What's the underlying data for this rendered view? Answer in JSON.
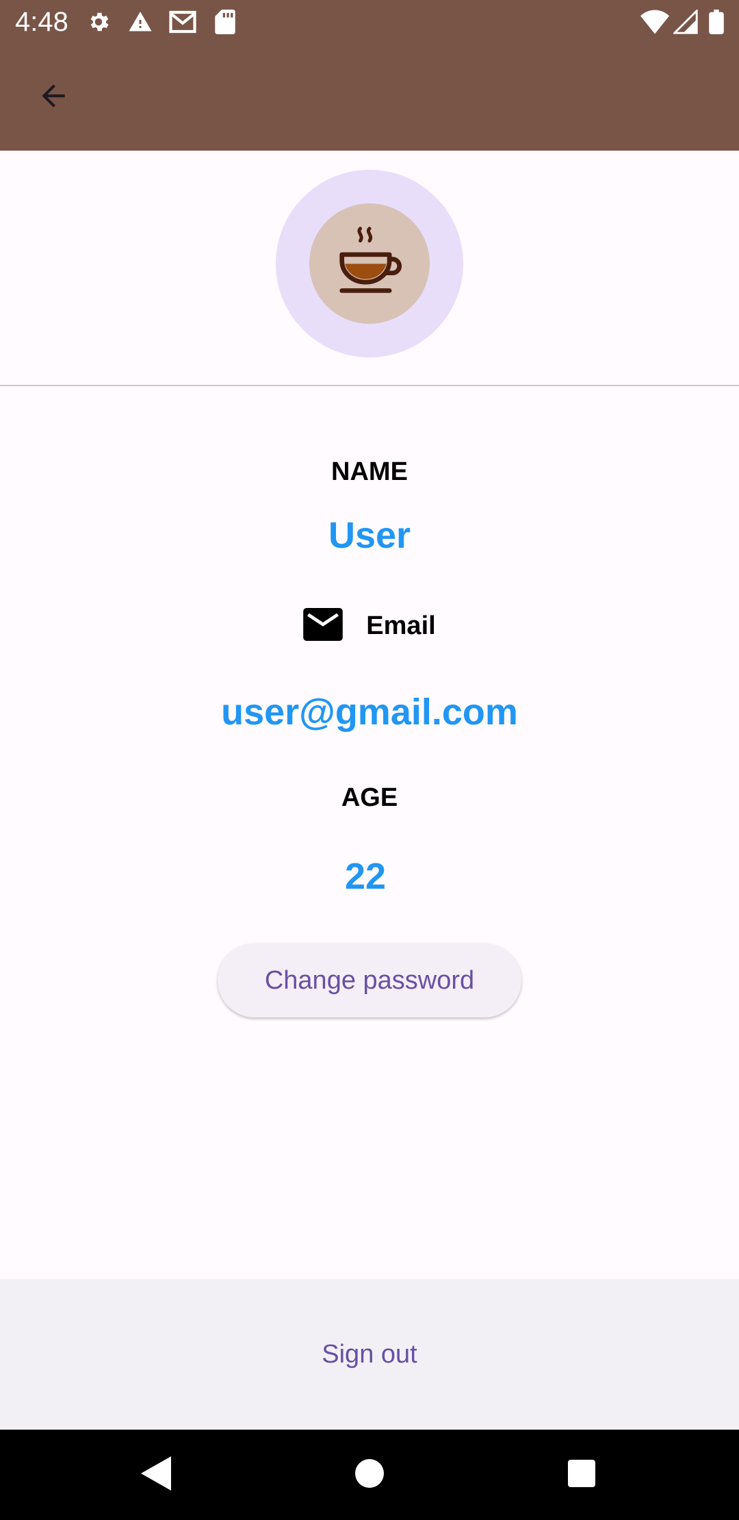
{
  "status_bar": {
    "time": "4:48",
    "left_icons": [
      "settings-icon",
      "warning-icon",
      "gmail-icon",
      "sd-card-icon"
    ],
    "right_icons": [
      "wifi-icon",
      "signal-icon",
      "battery-icon"
    ]
  },
  "app_bar": {
    "back_icon": "arrow-back-icon",
    "color": "#795548"
  },
  "avatar": {
    "icon": "coffee-cup-icon"
  },
  "profile": {
    "name_label": "NAME",
    "name_value": "User",
    "email_label": "Email",
    "email_value": "user@gmail.com",
    "age_label": "AGE",
    "age_value": "22"
  },
  "actions": {
    "change_password": "Change password",
    "sign_out": "Sign out"
  },
  "colors": {
    "value_text": "#2196f3",
    "button_text": "#6750a4"
  }
}
